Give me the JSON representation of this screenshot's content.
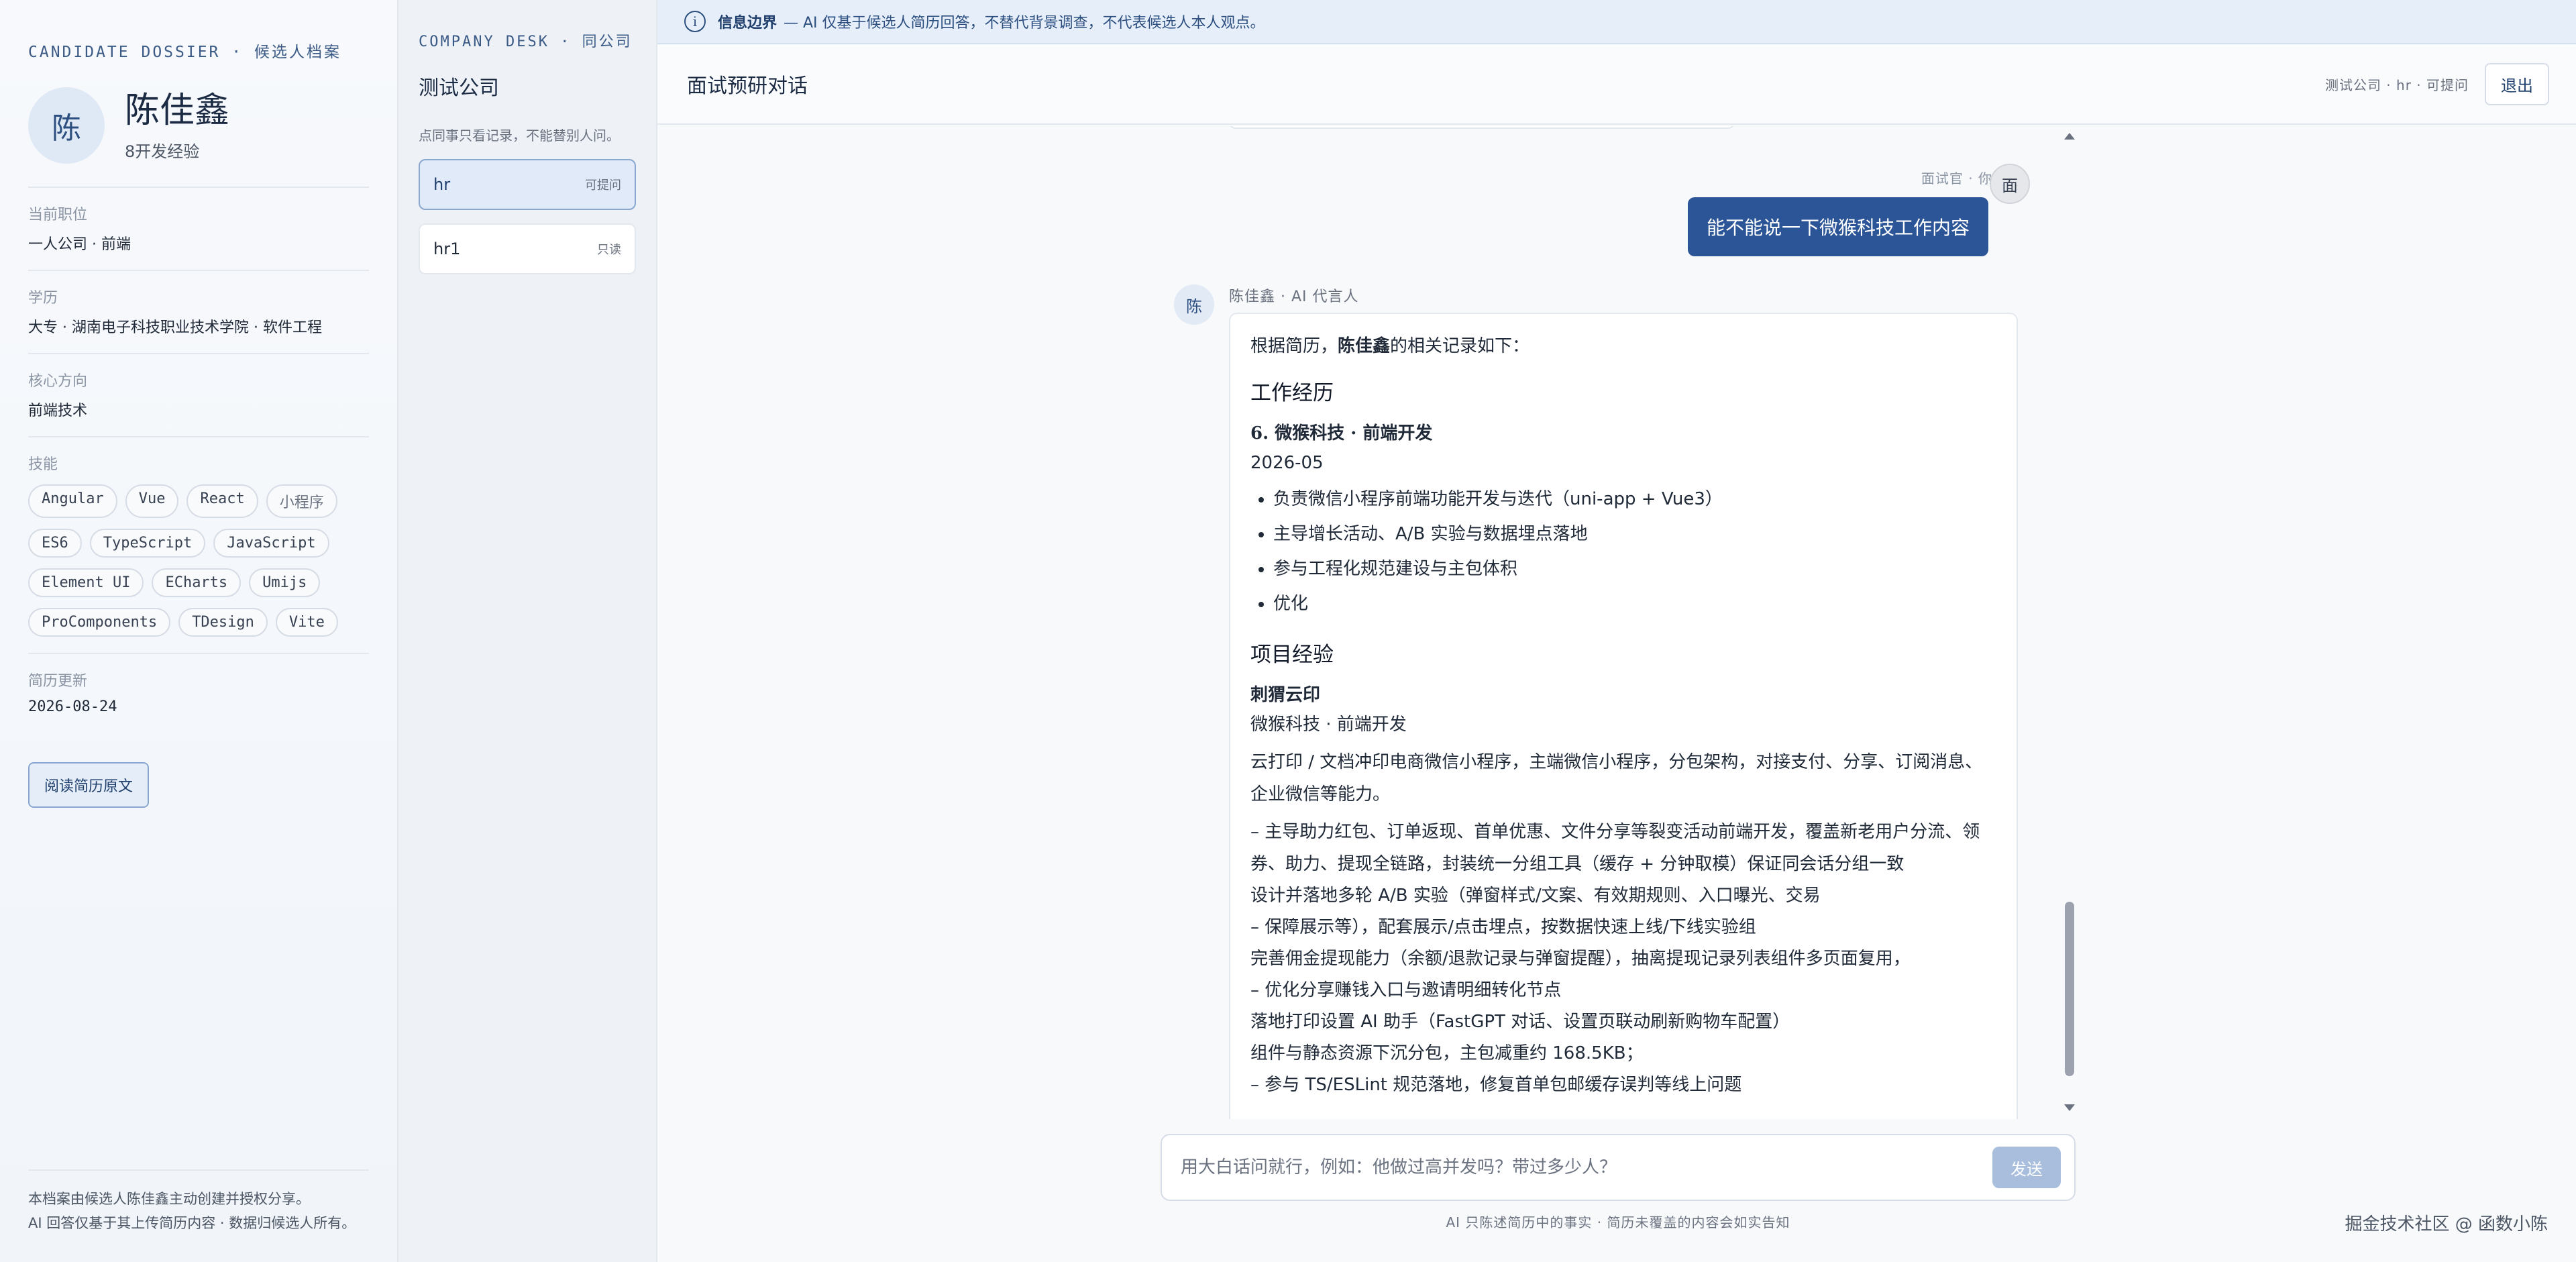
{
  "dossier": {
    "heading": "CANDIDATE DOSSIER · 候选人档案",
    "avatar_char": "陈",
    "name": "陈佳鑫",
    "experience": "8开发经验",
    "fields": [
      {
        "label": "当前职位",
        "value": "一人公司 · 前端"
      },
      {
        "label": "学历",
        "value": "大专 · 湖南电子科技职业技术学院 · 软件工程"
      },
      {
        "label": "核心方向",
        "value": "前端技术"
      }
    ],
    "skills_label": "技能",
    "skills": [
      "Angular",
      "Vue",
      "React",
      "小程序",
      "ES6",
      "TypeScript",
      "JavaScript",
      "Element UI",
      "ECharts",
      "Umijs",
      "ProComponents",
      "TDesign",
      "Vite"
    ],
    "updated_label": "简历更新",
    "updated_value": "2026-08-24",
    "read_button": "阅读简历原文",
    "footer_line1": "本档案由候选人陈佳鑫主动创建并授权分享。",
    "footer_line2": "AI 回答仅基于其上传简历内容 · 数据归候选人所有。"
  },
  "company": {
    "heading": "COMPANY DESK · 同公司",
    "name": "测试公司",
    "hint": "点同事只看记录，不能替别人问。",
    "contacts": [
      {
        "name": "hr",
        "tag": "可提问",
        "active": true
      },
      {
        "name": "hr1",
        "tag": "只读",
        "active": false
      }
    ]
  },
  "notice": {
    "title": "信息边界",
    "text": "— AI 仅基于候选人简历回答，不替代背景调查，不代表候选人本人观点。"
  },
  "topbar": {
    "title": "面试预研对话",
    "meta": "测试公司 · hr · 可提问",
    "logout": "退出"
  },
  "chat": {
    "user_meta": "面试官 · 你",
    "user_avatar": "面",
    "user_message": "能不能说一下微猴科技工作内容",
    "bot_avatar": "陈",
    "bot_meta": "陈佳鑫 · AI 代言人",
    "bot": {
      "lead_prefix": "根据简历，",
      "lead_name": "陈佳鑫",
      "lead_suffix": "的相关记录如下：",
      "section_work": "工作经历",
      "job_title": "6. 微猴科技 · 前端开发",
      "job_date": "2026-05",
      "job_bullets": [
        "负责微信小程序前端功能开发与迭代（uni-app + Vue3）",
        "主导增长活动、A/B 实验与数据埋点落地",
        "参与工程化规范建设与主包体积",
        "优化"
      ],
      "section_project": "项目经验",
      "project_name": "刺猬云印",
      "project_role": "微猴科技 · 前端开发",
      "project_desc": "云打印 / 文档冲印电商微信小程序，主端微信小程序，分包架构，对接支付、分享、订阅消息、企业微信等能力。",
      "project_lines": [
        "– 主导助力红包、订单返现、首单优惠、文件分享等裂变活动前端开发，覆盖新老用户分流、领券、助力、提现全链路，封装统一分组工具（缓存 + 分钟取模）保证同会话分组一致",
        "设计并落地多轮 A/B 实验（弹窗样式/文案、有效期规则、入口曝光、交易",
        "– 保障展示等），配套展示/点击埋点，按数据快速上线/下线实验组",
        "完善佣金提现能力（余额/退款记录与弹窗提醒），抽离提现记录列表组件多页面复用，",
        "– 优化分享赚钱入口与邀请明细转化节点",
        "落地打印设置 AI 助手（FastGPT 对话、设置页联动刷新购物车配置）",
        "组件与静态资源下沉分包，主包减重约 168.5KB；",
        "– 参与 TS/ESLint 规范落地，修复首单包邮缓存误判等线上问题"
      ]
    }
  },
  "composer": {
    "placeholder": "用大白话问就行，例如：他做过高并发吗？带过多少人？",
    "send": "发送"
  },
  "disclaimer": "AI 只陈述简历中的事实 · 简历未覆盖的内容会如实告知",
  "watermark": "掘金技术社区 @ 函数小陈"
}
